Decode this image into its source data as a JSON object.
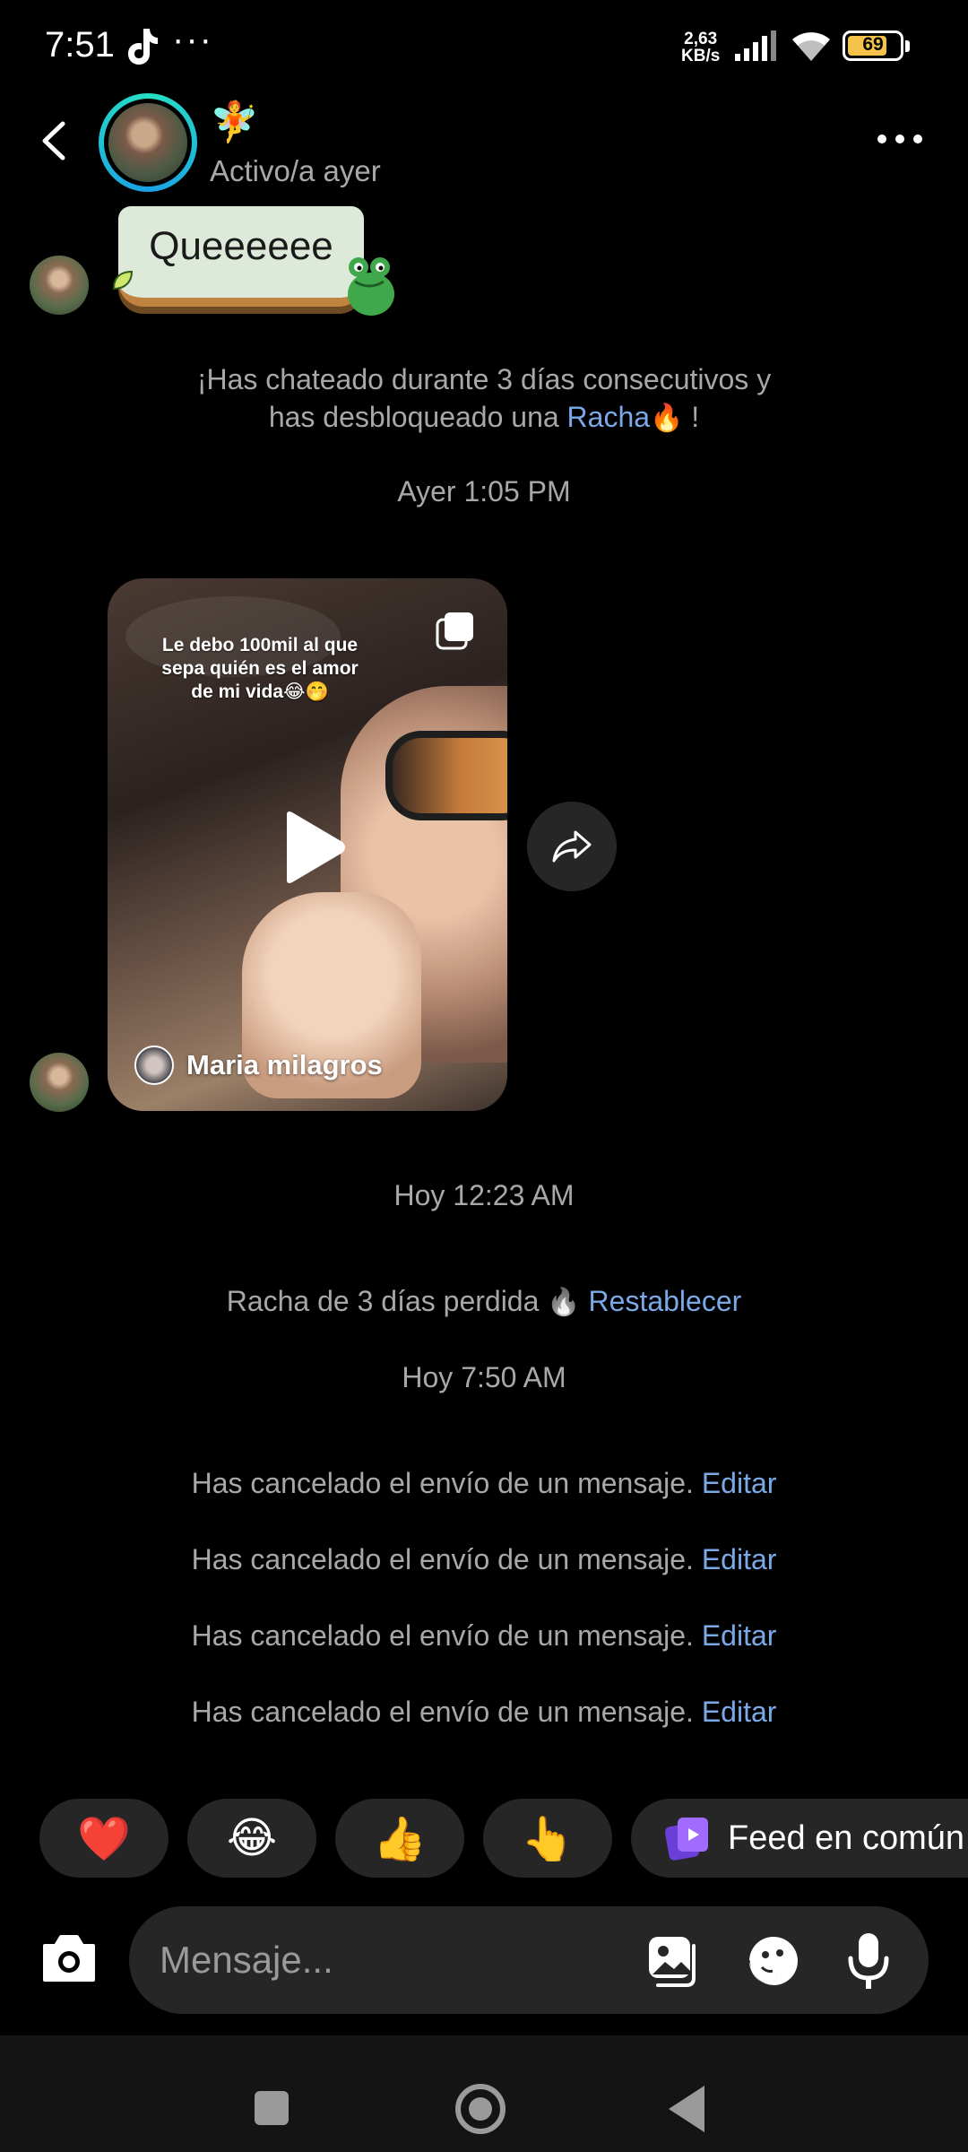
{
  "status_bar": {
    "time": "7:51",
    "more": "···",
    "net_speed_value": "2,63",
    "net_speed_unit": "KB/s",
    "battery": "69"
  },
  "header": {
    "contact_emoji": "🧚",
    "status": "Activo/a ayer"
  },
  "messages": {
    "sticker_text": "Queeeeee",
    "streak_line1": "¡Has chateado durante 3 días consecutivos y",
    "streak_line2_prefix": "has desbloqueado una ",
    "streak_link": "Racha",
    "streak_emoji": "🔥",
    "streak_suffix": " !",
    "timestamp_1": "Ayer 1:05 PM",
    "video_caption": "Le debo 100mil al que sepa quién es el amor de mi vida😂🤭",
    "video_user": "Maria milagros",
    "timestamp_2": "Hoy 12:23 AM",
    "streak_lost_text": "Racha de 3 días perdida",
    "streak_lost_emoji": "🔥",
    "restore_link": "Restablecer",
    "timestamp_3": "Hoy 7:50 AM",
    "unsent": [
      {
        "text": "Has cancelado el envío de un mensaje.",
        "link": "Editar"
      },
      {
        "text": "Has cancelado el envío de un mensaje.",
        "link": "Editar"
      },
      {
        "text": "Has cancelado el envío de un mensaje.",
        "link": "Editar"
      },
      {
        "text": "Has cancelado el envío de un mensaje.",
        "link": "Editar"
      }
    ]
  },
  "quick_replies": {
    "heart": "❤️",
    "laugh": "😂",
    "thumbs_up": "👍",
    "point": "👆",
    "feed_label": "Feed en común"
  },
  "composer": {
    "placeholder": "Mensaje..."
  },
  "colors": {
    "link": "#7aa9e8",
    "background": "#000000",
    "bubble": "#262626"
  }
}
